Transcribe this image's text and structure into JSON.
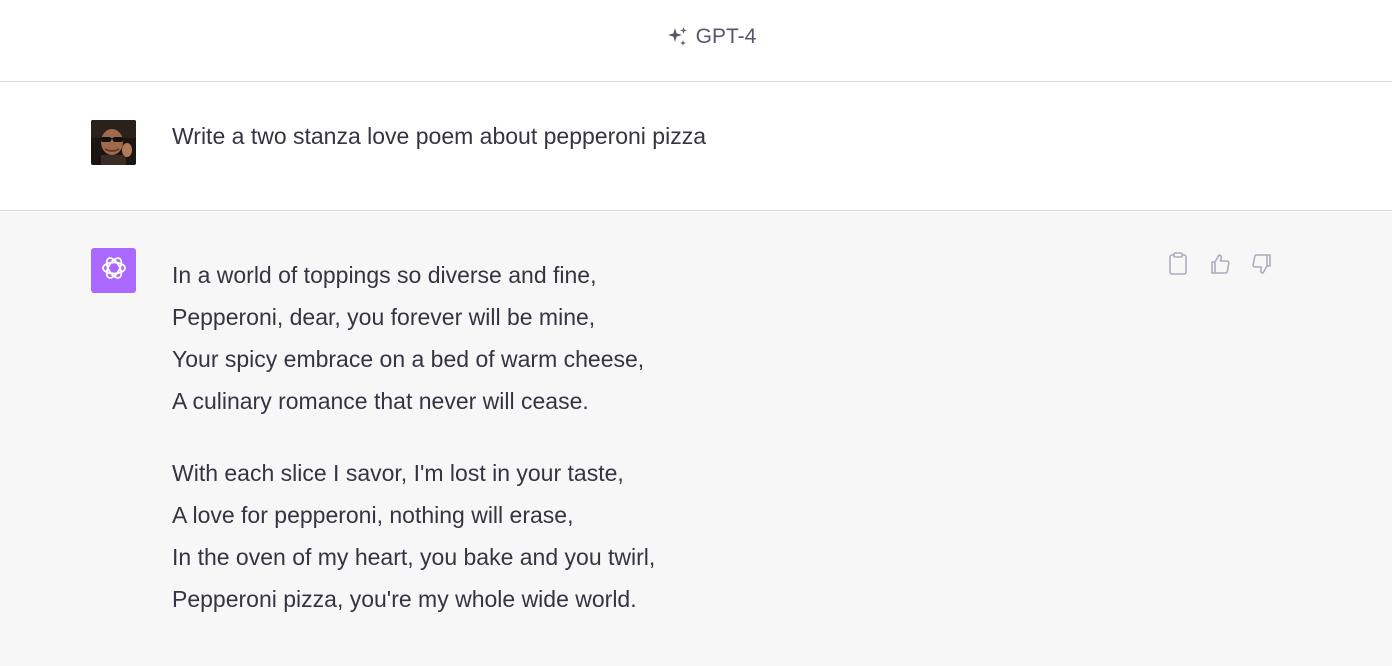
{
  "header": {
    "model_name": "GPT-4",
    "model_icon": "sparkle-icon"
  },
  "conversation": {
    "user_message": {
      "avatar": "user-avatar",
      "text": "Write a two stanza love poem about pepperoni pizza"
    },
    "assistant_message": {
      "avatar": "openai-logo-icon",
      "avatar_color": "#ab68ff",
      "stanzas": [
        {
          "lines": [
            "In a world of toppings so diverse and fine,",
            "Pepperoni, dear, you forever will be mine,",
            "Your spicy embrace on a bed of warm cheese,",
            "A culinary romance that never will cease."
          ]
        },
        {
          "lines": [
            "With each slice I savor, I'm lost in your taste,",
            "A love for pepperoni, nothing will erase,",
            "In the oven of my heart, you bake and you twirl,",
            "Pepperoni pizza, you're my whole wide world."
          ]
        }
      ],
      "actions": [
        "clipboard-icon",
        "thumbs-up-icon",
        "thumbs-down-icon"
      ]
    }
  },
  "colors": {
    "text": "#343541",
    "assistant_background": "#f7f7f8",
    "icon_gray": "#acacbe"
  }
}
